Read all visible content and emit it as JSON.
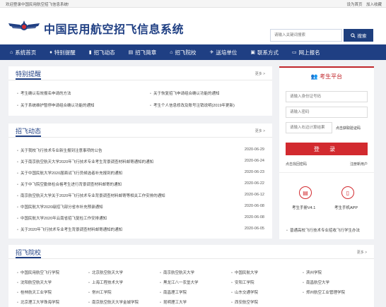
{
  "topbar": {
    "welcome": "欢迎登录中国民用航空招飞信息系统!",
    "links": [
      "设为首页",
      "加入收藏"
    ]
  },
  "header": {
    "title": "中国民用航空招飞信息系统",
    "search_placeholder": "请输入关键词搜索",
    "search_label": "搜索"
  },
  "nav": {
    "items": [
      {
        "label": "系统首页",
        "icon": "home-icon"
      },
      {
        "label": "特别提醒",
        "icon": "bell-icon"
      },
      {
        "label": "招飞动态",
        "icon": "chart-icon"
      },
      {
        "label": "招飞简章",
        "icon": "document-icon"
      },
      {
        "label": "招飞院校",
        "icon": "school-icon"
      },
      {
        "label": "送培单位",
        "icon": "plane-icon"
      },
      {
        "label": "联系方式",
        "icon": "contact-icon"
      },
      {
        "label": "网上报名",
        "icon": "monitor-icon"
      }
    ]
  },
  "reminder": {
    "title": "特别提醒",
    "more": "更多 >",
    "items": [
      "考生确认有效报名申请的方法",
      "关于系统维护暂停申请组合确认功能的通知",
      "关于恢复招飞申请组合确认功能的通知",
      "考生个人信息修改及账号注销说明(2019年更新)"
    ]
  },
  "news": {
    "title": "招飞动态",
    "more": "更多 >",
    "items": [
      {
        "title": "关于我校飞行技术专业新生报到注意事项的公告",
        "date": "2020-06-29"
      },
      {
        "title": "关于南京航空航天大学2020年飞行技术专业考生背景调查材料邮寄通知的通知",
        "date": "2020-06-24"
      },
      {
        "title": "关于中国民航大学2020届面试飞行员候选者补充报到的通知",
        "date": "2020-06-23"
      },
      {
        "title": "关于中飞院空勤体检合格考生进行背景调查材料邮寄的通知",
        "date": "2020-06-22"
      },
      {
        "title": "南京航空航天大学关于2020年飞行技术专业背景调查材料邮寄等相关工作安排的通知",
        "date": "2020-06-12"
      },
      {
        "title": "中国民航大学2020级招飞部分省市补充预录通知",
        "date": "2020-06-08"
      },
      {
        "title": "中国民航大学2020年云南省招飞复检工作安排通知",
        "date": "2020-06-08"
      },
      {
        "title": "关于2020年飞行技术专业考生背景调查材料邮寄通知的通知",
        "date": "2020-06-05"
      }
    ]
  },
  "schools": {
    "title": "招飞院校",
    "more": "更多 >",
    "items": [
      "中国民用航空飞行学院",
      "北京航空航天大学",
      "南京航空航天大学",
      "中国民航大学",
      "滨州学院",
      "沈阳航空航天大学",
      "上海工程技术大学",
      "黑龙江八一农垦大学",
      "安阳工学院",
      "南昌航空大学",
      "桂林航天工业学院",
      "常州工学院",
      "南昌理工学院",
      "山东交通学院",
      "郑州航空工业管理学院",
      "北京理工大学珠海学院",
      "南京航空航天大学金城学院",
      "昆明理工大学",
      "西安航空学院",
      ""
    ]
  },
  "login": {
    "title": "考生平台",
    "id_placeholder": "请输入身份证号码",
    "password_placeholder": "请输入密码",
    "captcha_placeholder": "请输入右边计算结果",
    "captcha_hint": "点击获取验证码",
    "login_label": "登 录",
    "forgot": "点击找回密码",
    "register": "注册新用户",
    "apps": [
      "考生手册V4.1",
      "考生手机APP"
    ]
  },
  "notice": "普通高校飞行技术专业招收飞行学生办法",
  "colors": {
    "brand": "#1f3f83",
    "accent": "#d22a2f"
  }
}
